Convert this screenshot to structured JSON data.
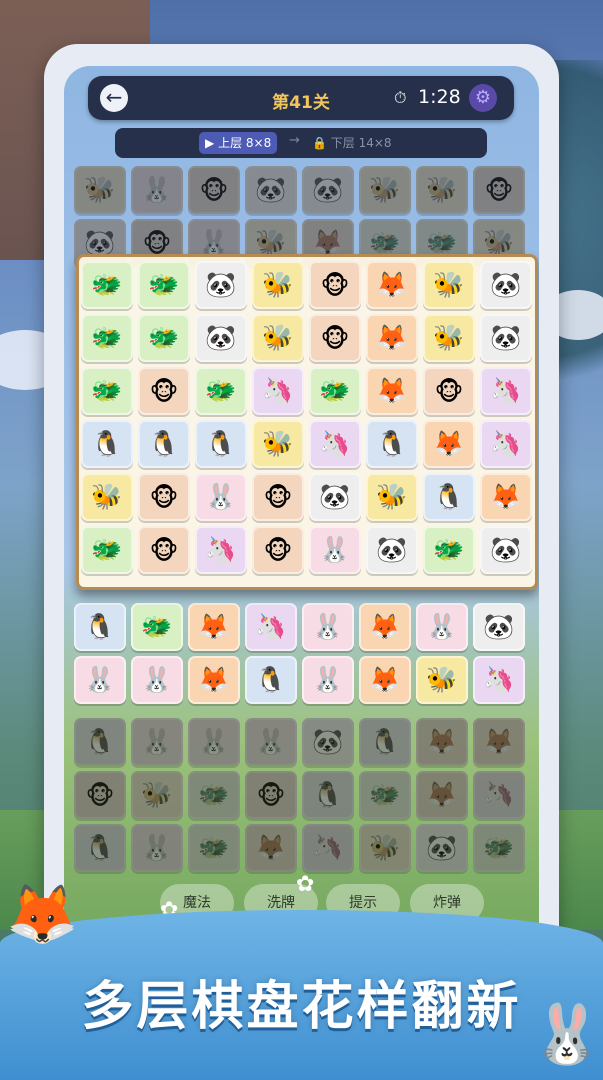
{
  "header": {
    "level_title": "第41关",
    "timer": "1:28"
  },
  "layers": {
    "upper_label": "上层 8×8",
    "lower_label": "下层 14×8"
  },
  "tools": [
    "魔法",
    "洗牌",
    "提示",
    "炸弹"
  ],
  "banner": {
    "text": "多层棋盘花样翻新"
  },
  "icons": {
    "back": "back-arrow-icon",
    "timer": "stopwatch-icon",
    "settings": "gear-icon",
    "play": "play-icon",
    "lock": "lock-icon"
  },
  "tile_glyphs": {
    "dragon": "🐲",
    "panda": "🐼",
    "bee": "🐝",
    "monkey": "🐵",
    "fox": "🦊",
    "unicorn": "🦄",
    "penguin": "🐧",
    "rabbit": "🐰",
    "raccoon": "🦝"
  },
  "tile_colors": {
    "dragon": "#d9efc4",
    "panda": "#eeeeee",
    "bee": "#f7e9a2",
    "monkey": "#f3d6bd",
    "fox": "#f9d5b2",
    "unicorn": "#ead8f3",
    "penguin": "#d5e3f3",
    "rabbit": "#f8dce5",
    "raccoon": "#dde3e8"
  },
  "upper_layer": [
    [
      "dragon",
      "dragon",
      "panda",
      "bee",
      "monkey",
      "fox",
      "bee",
      "panda"
    ],
    [
      "dragon",
      "dragon",
      "panda",
      "bee",
      "monkey",
      "fox",
      "bee",
      "panda"
    ],
    [
      "dragon",
      "monkey",
      "dragon",
      "unicorn",
      "dragon",
      "fox",
      "monkey",
      "unicorn"
    ],
    [
      "penguin",
      "penguin",
      "penguin",
      "bee",
      "unicorn",
      "penguin",
      "fox",
      "unicorn"
    ],
    [
      "bee",
      "monkey",
      "rabbit",
      "monkey",
      "panda",
      "bee",
      "penguin",
      "fox"
    ],
    [
      "dragon",
      "monkey",
      "unicorn",
      "monkey",
      "rabbit",
      "panda",
      "dragon",
      "panda"
    ]
  ],
  "lower_layer_top": [
    [
      "bee",
      "rabbit",
      "monkey",
      "panda",
      "panda",
      "bee",
      "bee",
      "monkey"
    ],
    [
      "panda",
      "monkey",
      "rabbit",
      "bee",
      "fox",
      "dragon",
      "dragon",
      "bee"
    ]
  ],
  "lower_layer_mid": [
    [
      "penguin",
      "dragon",
      "fox",
      "unicorn",
      "rabbit",
      "fox",
      "rabbit",
      "panda"
    ],
    [
      "rabbit",
      "rabbit",
      "fox",
      "penguin",
      "rabbit",
      "fox",
      "bee",
      "unicorn"
    ]
  ],
  "lower_layer_bottom": [
    [
      "penguin",
      "rabbit",
      "rabbit",
      "rabbit",
      "panda",
      "penguin",
      "fox",
      "fox"
    ],
    [
      "monkey",
      "bee",
      "dragon",
      "monkey",
      "penguin",
      "dragon",
      "fox",
      "unicorn"
    ],
    [
      "penguin",
      "rabbit",
      "dragon",
      "fox",
      "unicorn",
      "bee",
      "panda",
      "dragon"
    ]
  ]
}
